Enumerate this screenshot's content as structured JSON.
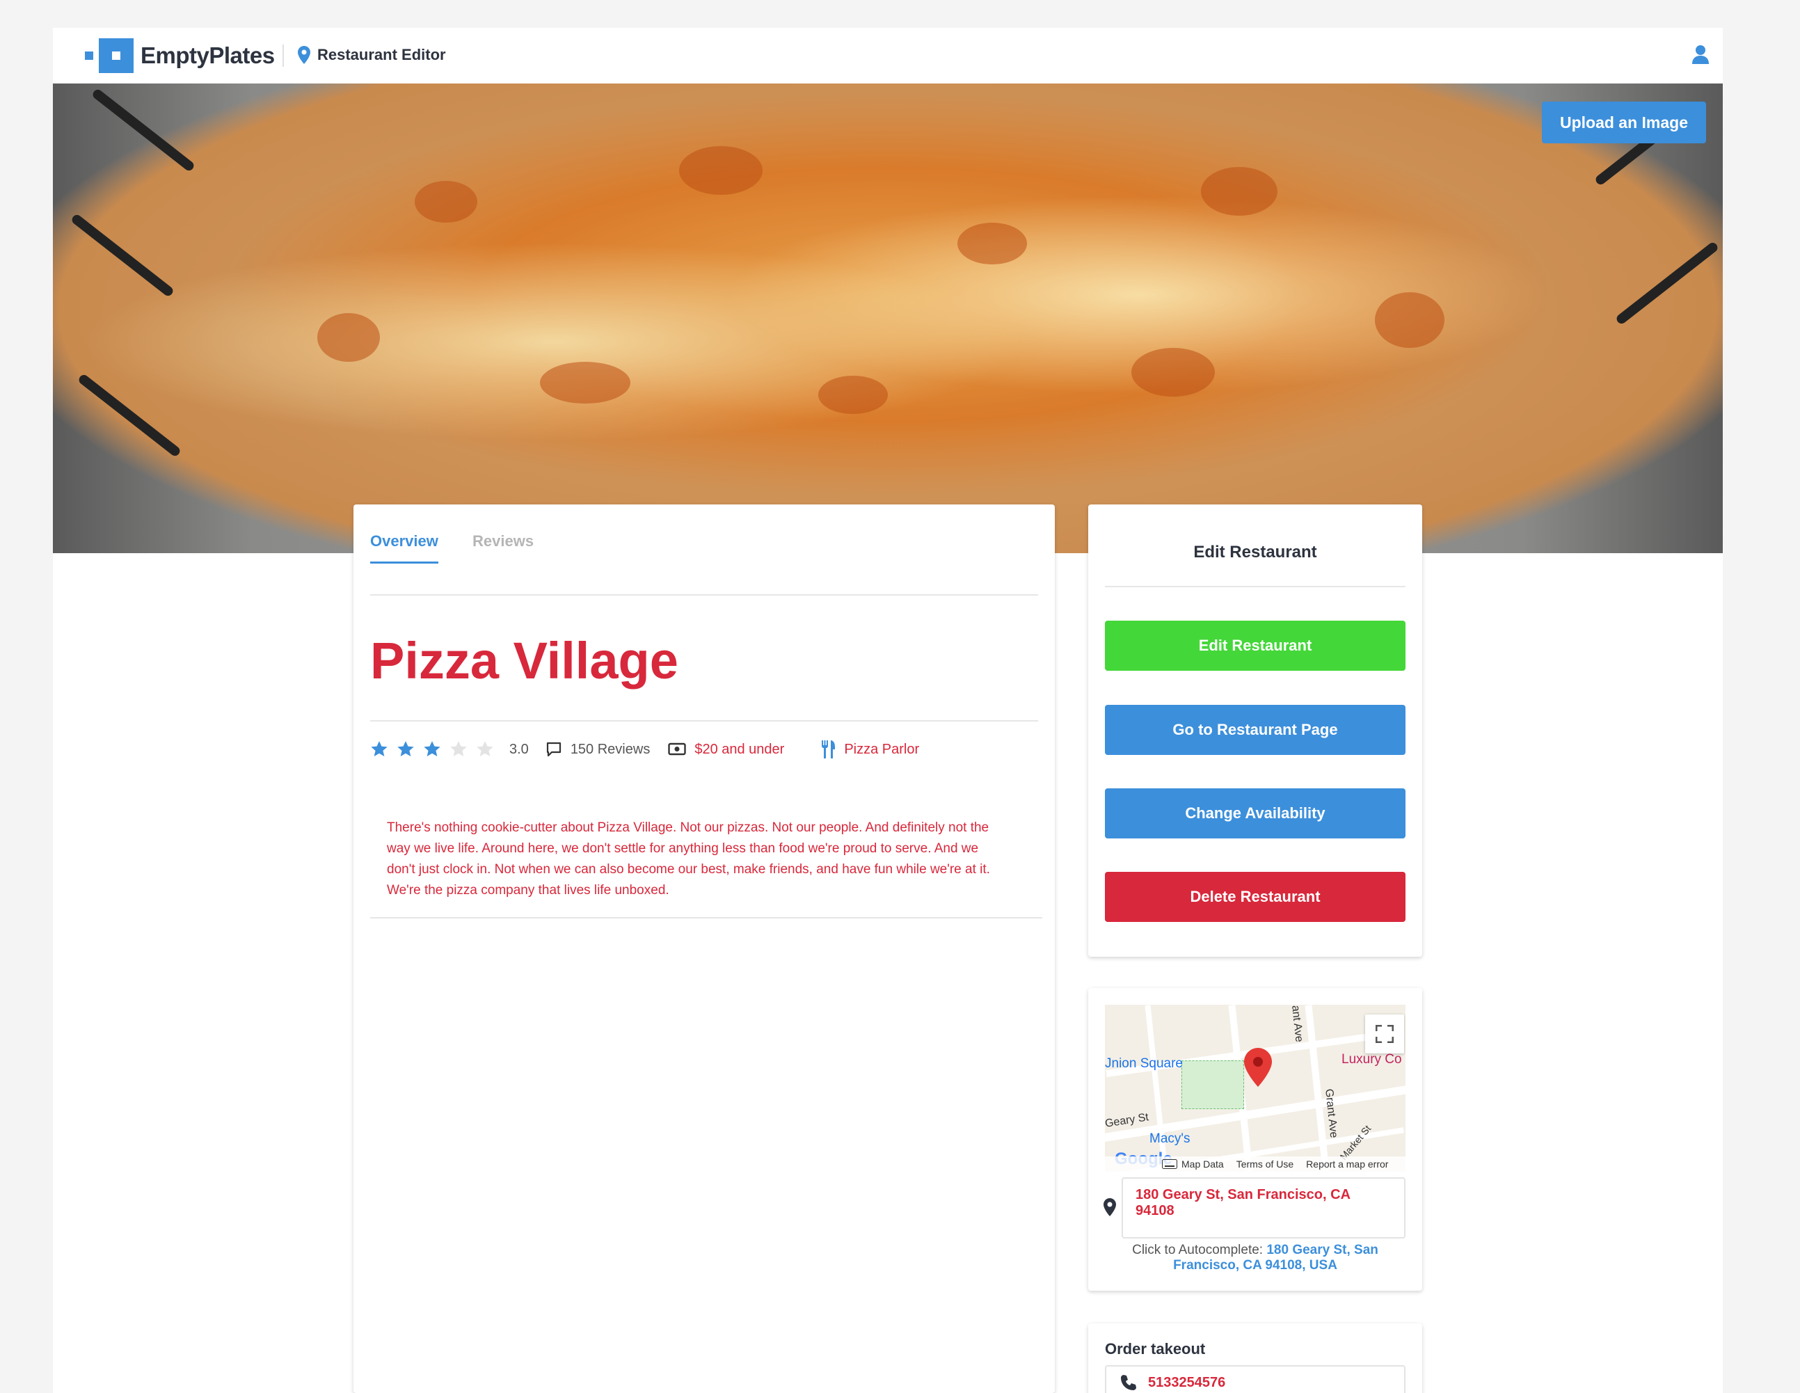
{
  "header": {
    "brand": "EmptyPlates",
    "section_link": "Restaurant Editor"
  },
  "hero": {
    "upload_label": "Upload an Image",
    "image_subject": "cheese pizza"
  },
  "tabs": [
    {
      "label": "Overview",
      "active": true
    },
    {
      "label": "Reviews",
      "active": false
    }
  ],
  "restaurant": {
    "name": "Pizza Village",
    "rating": 3,
    "rating_label": "3.0",
    "stars_total": 5,
    "reviews_label": "150 Reviews",
    "price_label": "$20 and under",
    "category_label": "Pizza Parlor",
    "description": "There's nothing cookie-cutter about Pizza Village. Not our pizzas. Not our people. And definitely not the way we live life. Around here, we don't settle for anything less than food we're proud to serve. And we don't just clock in. Not when we can also become our best, make friends, and have fun while we're at it. We're the pizza company that lives life unboxed."
  },
  "edit_panel": {
    "title": "Edit Restaurant",
    "buttons": {
      "edit": "Edit Restaurant",
      "go_to_page": "Go to Restaurant Page",
      "availability": "Change Availability",
      "delete": "Delete Restaurant"
    }
  },
  "map": {
    "labels": {
      "union_square": "Jnion Square",
      "luxury": "Luxury Co",
      "geary": "Geary St",
      "macys": "Macy's",
      "grant_ave": "Grant Ave",
      "grant_ave_top": "ant Ave",
      "market_st": "Market St",
      "google": "Google"
    },
    "footer": {
      "map_data": "Map Data",
      "terms": "Terms of Use",
      "report": "Report a map error"
    },
    "address_value": "180 Geary St, San Francisco, CA 94108",
    "autocomplete_prefix": "Click to Autocomplete: ",
    "autocomplete_suggestion": "180 Geary St, San Francisco, CA 94108, USA"
  },
  "order": {
    "title": "Order takeout",
    "phone": "5133254576"
  },
  "colors": {
    "brand_blue": "#3c8fdb",
    "accent_red": "#d8283b",
    "success_green": "#44d739"
  },
  "icons": [
    "location-pin-icon",
    "user-icon",
    "star-icon",
    "comment-icon",
    "money-icon",
    "utensils-icon",
    "fullscreen-icon",
    "phone-icon",
    "keyboard-icon",
    "map-marker-icon"
  ]
}
